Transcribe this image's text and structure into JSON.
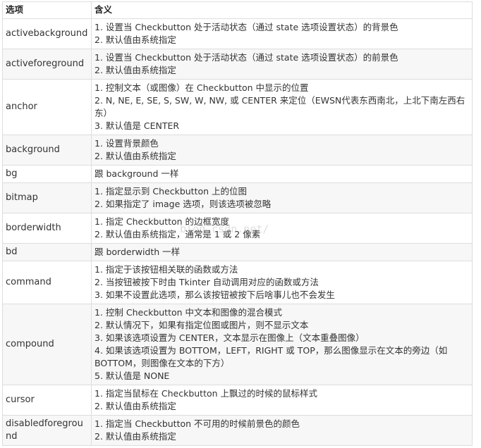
{
  "header": {
    "col_option": "选项",
    "col_meaning": "含义"
  },
  "rows": [
    {
      "option": "activebackground",
      "lines": [
        "1. 设置当 Checkbutton 处于活动状态（通过 state 选项设置状态）的背景色",
        "2. 默认值由系统指定"
      ]
    },
    {
      "option": "activeforeground",
      "lines": [
        "1. 设置当 Checkbutton 处于活动状态（通过 state 选项设置状态）的前景色",
        "2. 默认值由系统指定"
      ]
    },
    {
      "option": "anchor",
      "lines": [
        "1. 控制文本（或图像）在 Checkbutton 中显示的位置",
        "2. N, NE, E, SE, S, SW, W, NW, 或 CENTER 来定位（EWSN代表东西南北，上北下南左西右东）",
        "3. 默认值是 CENTER"
      ]
    },
    {
      "option": "background",
      "lines": [
        "1. 设置背景颜色",
        "2. 默认值由系统指定"
      ]
    },
    {
      "option": "bg",
      "lines": [
        "跟 background 一样"
      ]
    },
    {
      "option": "bitmap",
      "lines": [
        "1. 指定显示到 Checkbutton 上的位图",
        "2. 如果指定了 image 选项，则该选项被忽略"
      ]
    },
    {
      "option": "borderwidth",
      "lines": [
        "1. 指定 Checkbutton 的边框宽度",
        "2. 默认值由系统指定，通常是 1 或 2 像素"
      ]
    },
    {
      "option": "bd",
      "lines": [
        "跟 borderwidth 一样"
      ]
    },
    {
      "option": "command",
      "lines": [
        "1. 指定于该按钮相关联的函数或方法",
        "2. 当按钮被按下时由 Tkinter 自动调用对应的函数或方法",
        "3. 如果不设置此选项，那么该按钮被按下后啥事儿也不会发生"
      ]
    },
    {
      "option": "compound",
      "lines": [
        "1. 控制 Checkbutton 中文本和图像的混合模式",
        "2. 默认情况下，如果有指定位图或图片，则不显示文本",
        "3. 如果该选项设置为 CENTER，文本显示在图像上（文本重叠图像）",
        "4. 如果该选项设置为 BOTTOM，LEFT，RIGHT 或 TOP，那么图像显示在文本的旁边（如 BOTTOM，则图像在文本的下方）",
        "5. 默认值是 NONE"
      ]
    },
    {
      "option": "cursor",
      "lines": [
        "1. 指定当鼠标在 Checkbutton 上飘过的时候的鼠标样式",
        "2. 默认值由系统指定"
      ]
    },
    {
      "option": "disabledforeground",
      "lines": [
        "1. 指定当 Checkbutton 不可用的时候前景色的颜色",
        "2. 默认值由系统指定"
      ]
    }
  ],
  "watermark": "blog.csdn.net/",
  "colors": {
    "border": "#dddddd",
    "alt_row": "#f7f7f7",
    "text": "#333333"
  }
}
